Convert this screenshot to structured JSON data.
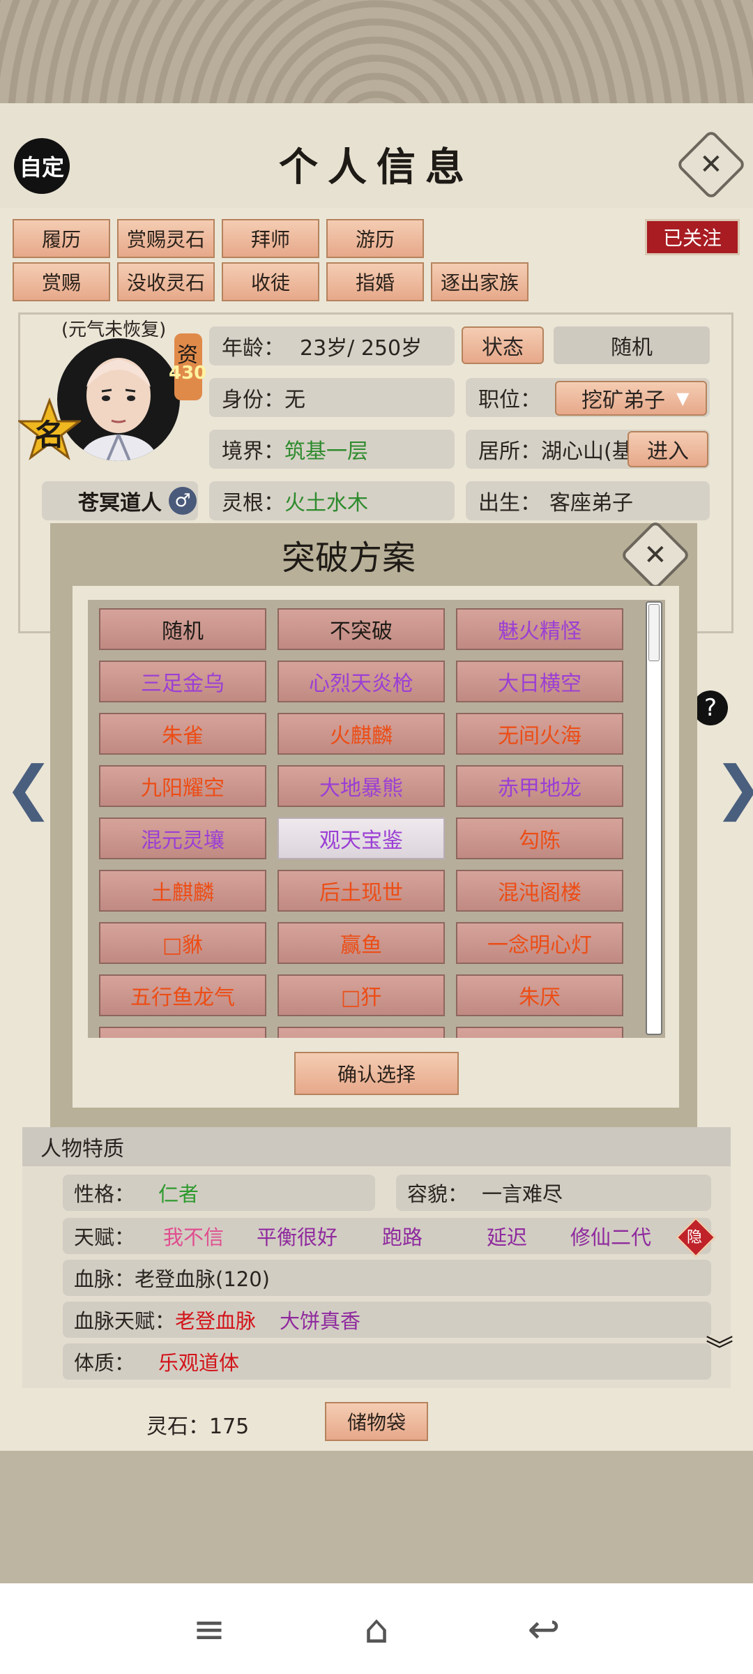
{
  "header": {
    "title": "个人信息",
    "auto_label": "自定"
  },
  "tabs_row1": [
    "履历",
    "赏赐灵石",
    "拜师",
    "游历"
  ],
  "tabs_row2": [
    "赏赐",
    "没收灵石",
    "收徒",
    "指婚",
    "逐出家族"
  ],
  "follow_label": "已关注",
  "profile": {
    "status_note": "(元气未恢复)",
    "aptitude_label": "资",
    "aptitude_value": "430",
    "fame_label": "名",
    "name": "苍冥道人",
    "gender_icon": "male-icon"
  },
  "info": {
    "age_label": "年龄：",
    "age_value": "23岁/ 250岁",
    "state_button": "状态",
    "random_button": "随机",
    "identity_label": "身份：",
    "identity_value": "无",
    "position_label": "职位：",
    "position_value": "挖矿弟子",
    "realm_label": "境界：",
    "realm_value": "筑基一层",
    "residence_label": "居所：",
    "residence_value": "湖心山(基",
    "enter_button": "进入",
    "root_label": "灵根：",
    "root_value": "火土水木",
    "birth_label": "出生：",
    "birth_value": "客座弟子"
  },
  "modal": {
    "title": "突破方案",
    "options": [
      {
        "label": "随机",
        "color": "black",
        "selected": false
      },
      {
        "label": "不突破",
        "color": "black",
        "selected": false
      },
      {
        "label": "魅火精怪",
        "color": "purple",
        "selected": false
      },
      {
        "label": "三足金乌",
        "color": "purple",
        "selected": false
      },
      {
        "label": "心烈天炎枪",
        "color": "purple",
        "selected": false
      },
      {
        "label": "大日横空",
        "color": "purple",
        "selected": false
      },
      {
        "label": "朱雀",
        "color": "orange",
        "selected": false
      },
      {
        "label": "火麒麟",
        "color": "orange",
        "selected": false
      },
      {
        "label": "无间火海",
        "color": "orange",
        "selected": false
      },
      {
        "label": "九阳耀空",
        "color": "orange",
        "selected": false
      },
      {
        "label": "大地暴熊",
        "color": "purple",
        "selected": false
      },
      {
        "label": "赤甲地龙",
        "color": "purple",
        "selected": false
      },
      {
        "label": "混元灵壤",
        "color": "purple",
        "selected": false
      },
      {
        "label": "观天宝鉴",
        "color": "purple",
        "selected": true
      },
      {
        "label": "勾陈",
        "color": "orange",
        "selected": false
      },
      {
        "label": "土麒麟",
        "color": "orange",
        "selected": false
      },
      {
        "label": "后土现世",
        "color": "orange",
        "selected": false
      },
      {
        "label": "混沌阁楼",
        "color": "orange",
        "selected": false
      },
      {
        "label": "□貅",
        "color": "orange",
        "selected": false
      },
      {
        "label": "赢鱼",
        "color": "orange",
        "selected": false
      },
      {
        "label": "一念明心灯",
        "color": "orange",
        "selected": false
      },
      {
        "label": "五行鱼龙气",
        "color": "orange",
        "selected": false
      },
      {
        "label": "□犴",
        "color": "orange",
        "selected": false
      },
      {
        "label": "朱厌",
        "color": "orange",
        "selected": false
      }
    ],
    "confirm_label": "确认选择"
  },
  "traits": {
    "section_title": "人物特质",
    "personality_label": "性格：",
    "personality_value": "仁者",
    "appearance_label": "容貌：",
    "appearance_value": "一言难尽",
    "talent_label": "天赋：",
    "talents": [
      "我不信",
      "平衡很好",
      "跑路",
      "延迟",
      "修仙二代"
    ],
    "hidden_label": "隐",
    "bloodline_label": "血脉：",
    "bloodline_value": "老登血脉(120)",
    "bloodline_talent_label": "血脉天赋：",
    "bloodline_talents": [
      "老登血脉",
      "大饼真香"
    ],
    "constitution_label": "体质：",
    "constitution_value": "乐观道体"
  },
  "footer": {
    "spirit_stones": "灵石：175",
    "bag_button": "储物袋"
  },
  "colors": {
    "peach": "#e7a88a",
    "follow_red": "#a81c22",
    "modal_bg": "#b8b098",
    "purple": "#9b3fd4",
    "orange": "#ec4d16"
  }
}
